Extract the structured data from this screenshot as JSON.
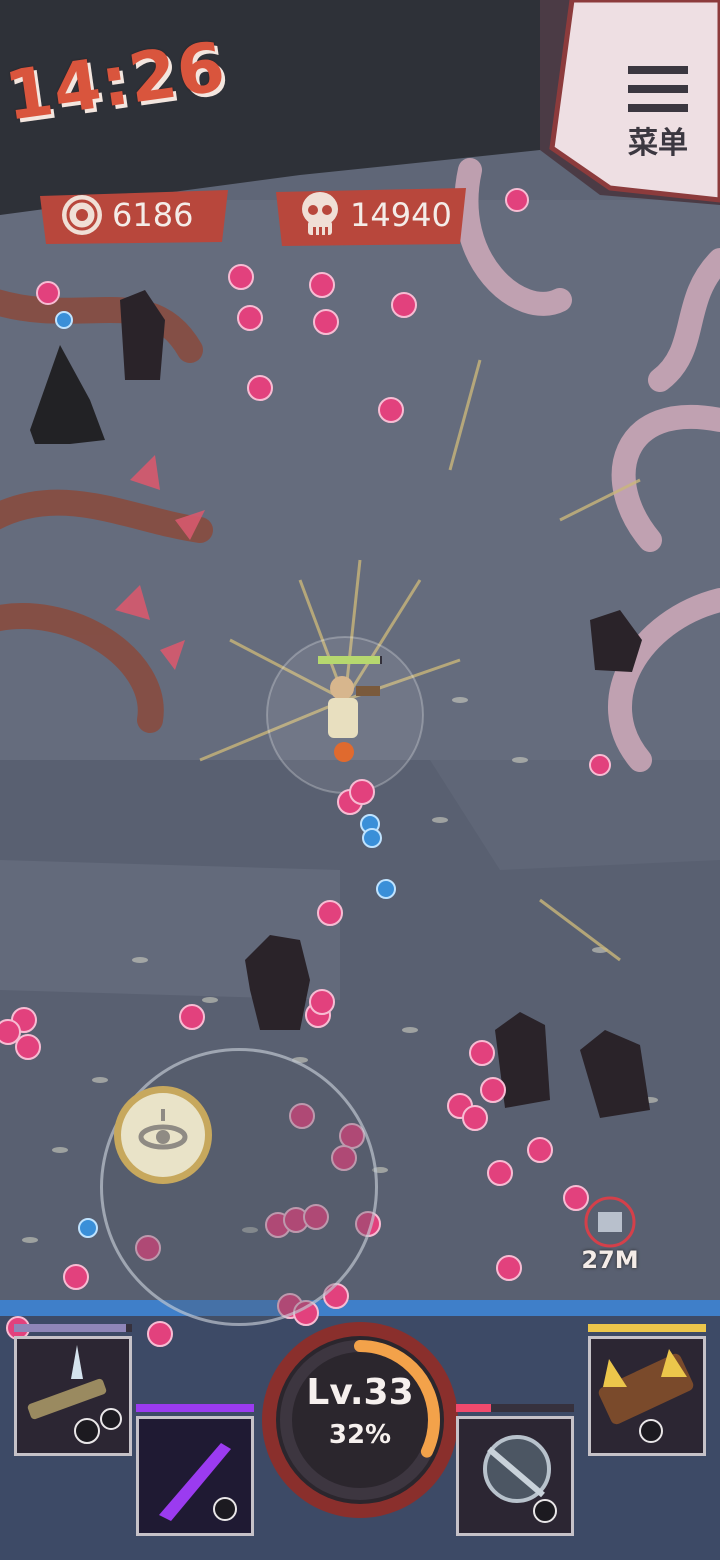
{
  "hud": {
    "timer": "14:26",
    "coins": "6186",
    "kills": "14940",
    "menu_label": "菜单",
    "distance": "27M",
    "level": "Lv.33",
    "level_percent": "32%"
  },
  "xp_progress": 0.32,
  "skills": [
    {
      "name": "rocket-launcher-icon",
      "cooldown": 0.95,
      "color": "#8f86b8"
    },
    {
      "name": "shadow-blade-icon",
      "cooldown": 1.0,
      "color": "#9b3bf0"
    },
    {
      "name": "chain-wrecking-icon",
      "cooldown": 0.3,
      "color": "#f04a6d"
    },
    {
      "name": "gold-spike-icon",
      "cooldown": 1.0,
      "color": "#ecc64b"
    }
  ],
  "colors": {
    "accent_timer": "#d9553d",
    "banner_red": "#b8473c",
    "orb_pink": "#e2417d",
    "orb_blue": "#3a8fd8",
    "ground": "#5f6677"
  }
}
